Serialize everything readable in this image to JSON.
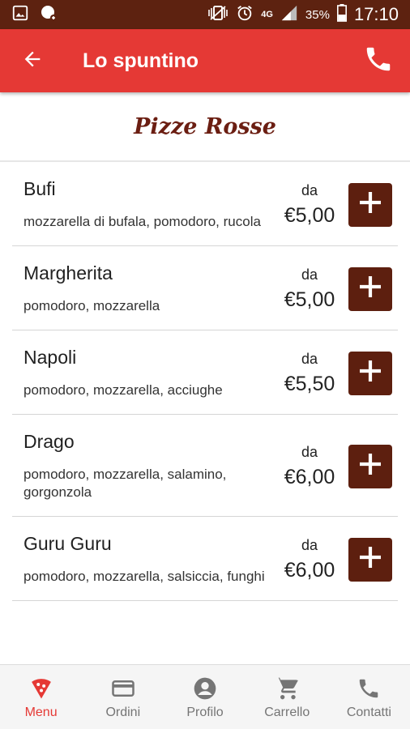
{
  "status_bar": {
    "network": "4G",
    "battery": "35%",
    "time": "17:10",
    "icons": [
      "gallery-icon",
      "chat-icon",
      "vibrate-icon",
      "alarm-icon",
      "signal-icon",
      "battery-icon"
    ]
  },
  "app_bar": {
    "title": "Lo spuntino",
    "back_icon": "arrow-back-icon",
    "call_icon": "phone-icon"
  },
  "section": {
    "title": "Pizze Rosse"
  },
  "items": [
    {
      "name": "Bufi",
      "description": "mozzarella di bufala, pomodoro, rucola",
      "price_prefix": "da",
      "price": "€5,00"
    },
    {
      "name": "Margherita",
      "description": "pomodoro, mozzarella",
      "price_prefix": "da",
      "price": "€5,00"
    },
    {
      "name": "Napoli",
      "description": "pomodoro, mozzarella, acciughe",
      "price_prefix": "da",
      "price": "€5,50"
    },
    {
      "name": "Drago",
      "description": "pomodoro, mozzarella, salamino, gorgonzola",
      "price_prefix": "da",
      "price": "€6,00"
    },
    {
      "name": "Guru Guru",
      "description": "pomodoro, mozzarella, salsiccia, funghi",
      "price_prefix": "da",
      "price": "€6,00"
    }
  ],
  "bottom_nav": [
    {
      "label": "Menu",
      "icon": "pizza-icon",
      "active": true
    },
    {
      "label": "Ordini",
      "icon": "card-icon",
      "active": false
    },
    {
      "label": "Profilo",
      "icon": "account-icon",
      "active": false
    },
    {
      "label": "Carrello",
      "icon": "cart-icon",
      "active": false
    },
    {
      "label": "Contatti",
      "icon": "phone-icon",
      "active": false
    }
  ],
  "colors": {
    "status_bar": "#5d2210",
    "app_bar": "#e53935",
    "accent_dark": "#5d1f0f",
    "section_title": "#6b1e12",
    "nav_active": "#e53935"
  }
}
